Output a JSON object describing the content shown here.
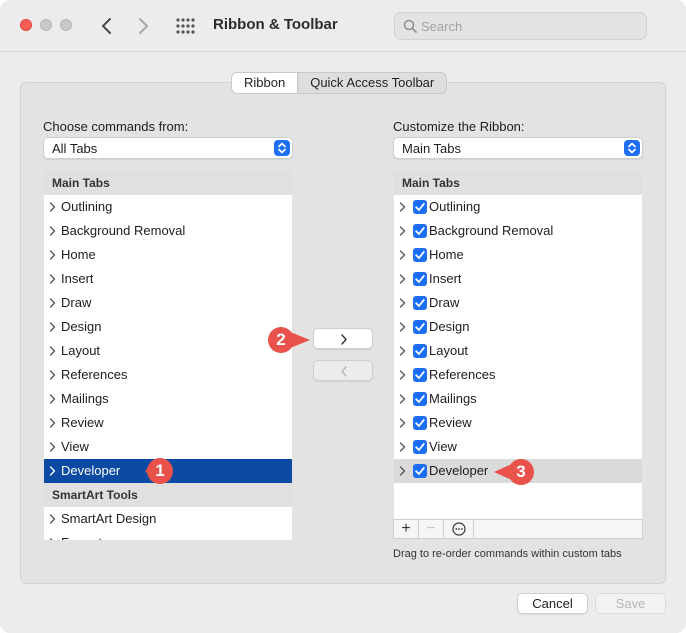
{
  "window": {
    "title": "Ribbon & Toolbar",
    "search_placeholder": "Search"
  },
  "tabs": [
    {
      "label": "Ribbon",
      "active": true
    },
    {
      "label": "Quick Access Toolbar",
      "active": false
    }
  ],
  "left": {
    "label": "Choose commands from:",
    "dropdown_value": "All Tabs",
    "header": "Main Tabs",
    "items": [
      "Outlining",
      "Background Removal",
      "Home",
      "Insert",
      "Draw",
      "Design",
      "Layout",
      "References",
      "Mailings",
      "Review",
      "View",
      "Developer"
    ],
    "selected": "Developer",
    "header2": "SmartArt Tools",
    "items2": [
      "SmartArt Design",
      "Format"
    ]
  },
  "right": {
    "label": "Customize the Ribbon:",
    "dropdown_value": "Main Tabs",
    "header": "Main Tabs",
    "items": [
      "Outlining",
      "Background Removal",
      "Home",
      "Insert",
      "Draw",
      "Design",
      "Layout",
      "References",
      "Mailings",
      "Review",
      "View",
      "Developer"
    ],
    "highlighted": "Developer",
    "hint": "Drag to re-order commands within custom tabs"
  },
  "footer_buttons": {
    "add": "+",
    "remove": "−"
  },
  "callouts": [
    "1",
    "2",
    "3"
  ],
  "actions": {
    "cancel": "Cancel",
    "save": "Save"
  },
  "colors": {
    "accent": "#1e6ef3",
    "selection": "#0a4aa2",
    "callout": "#e8524a"
  }
}
